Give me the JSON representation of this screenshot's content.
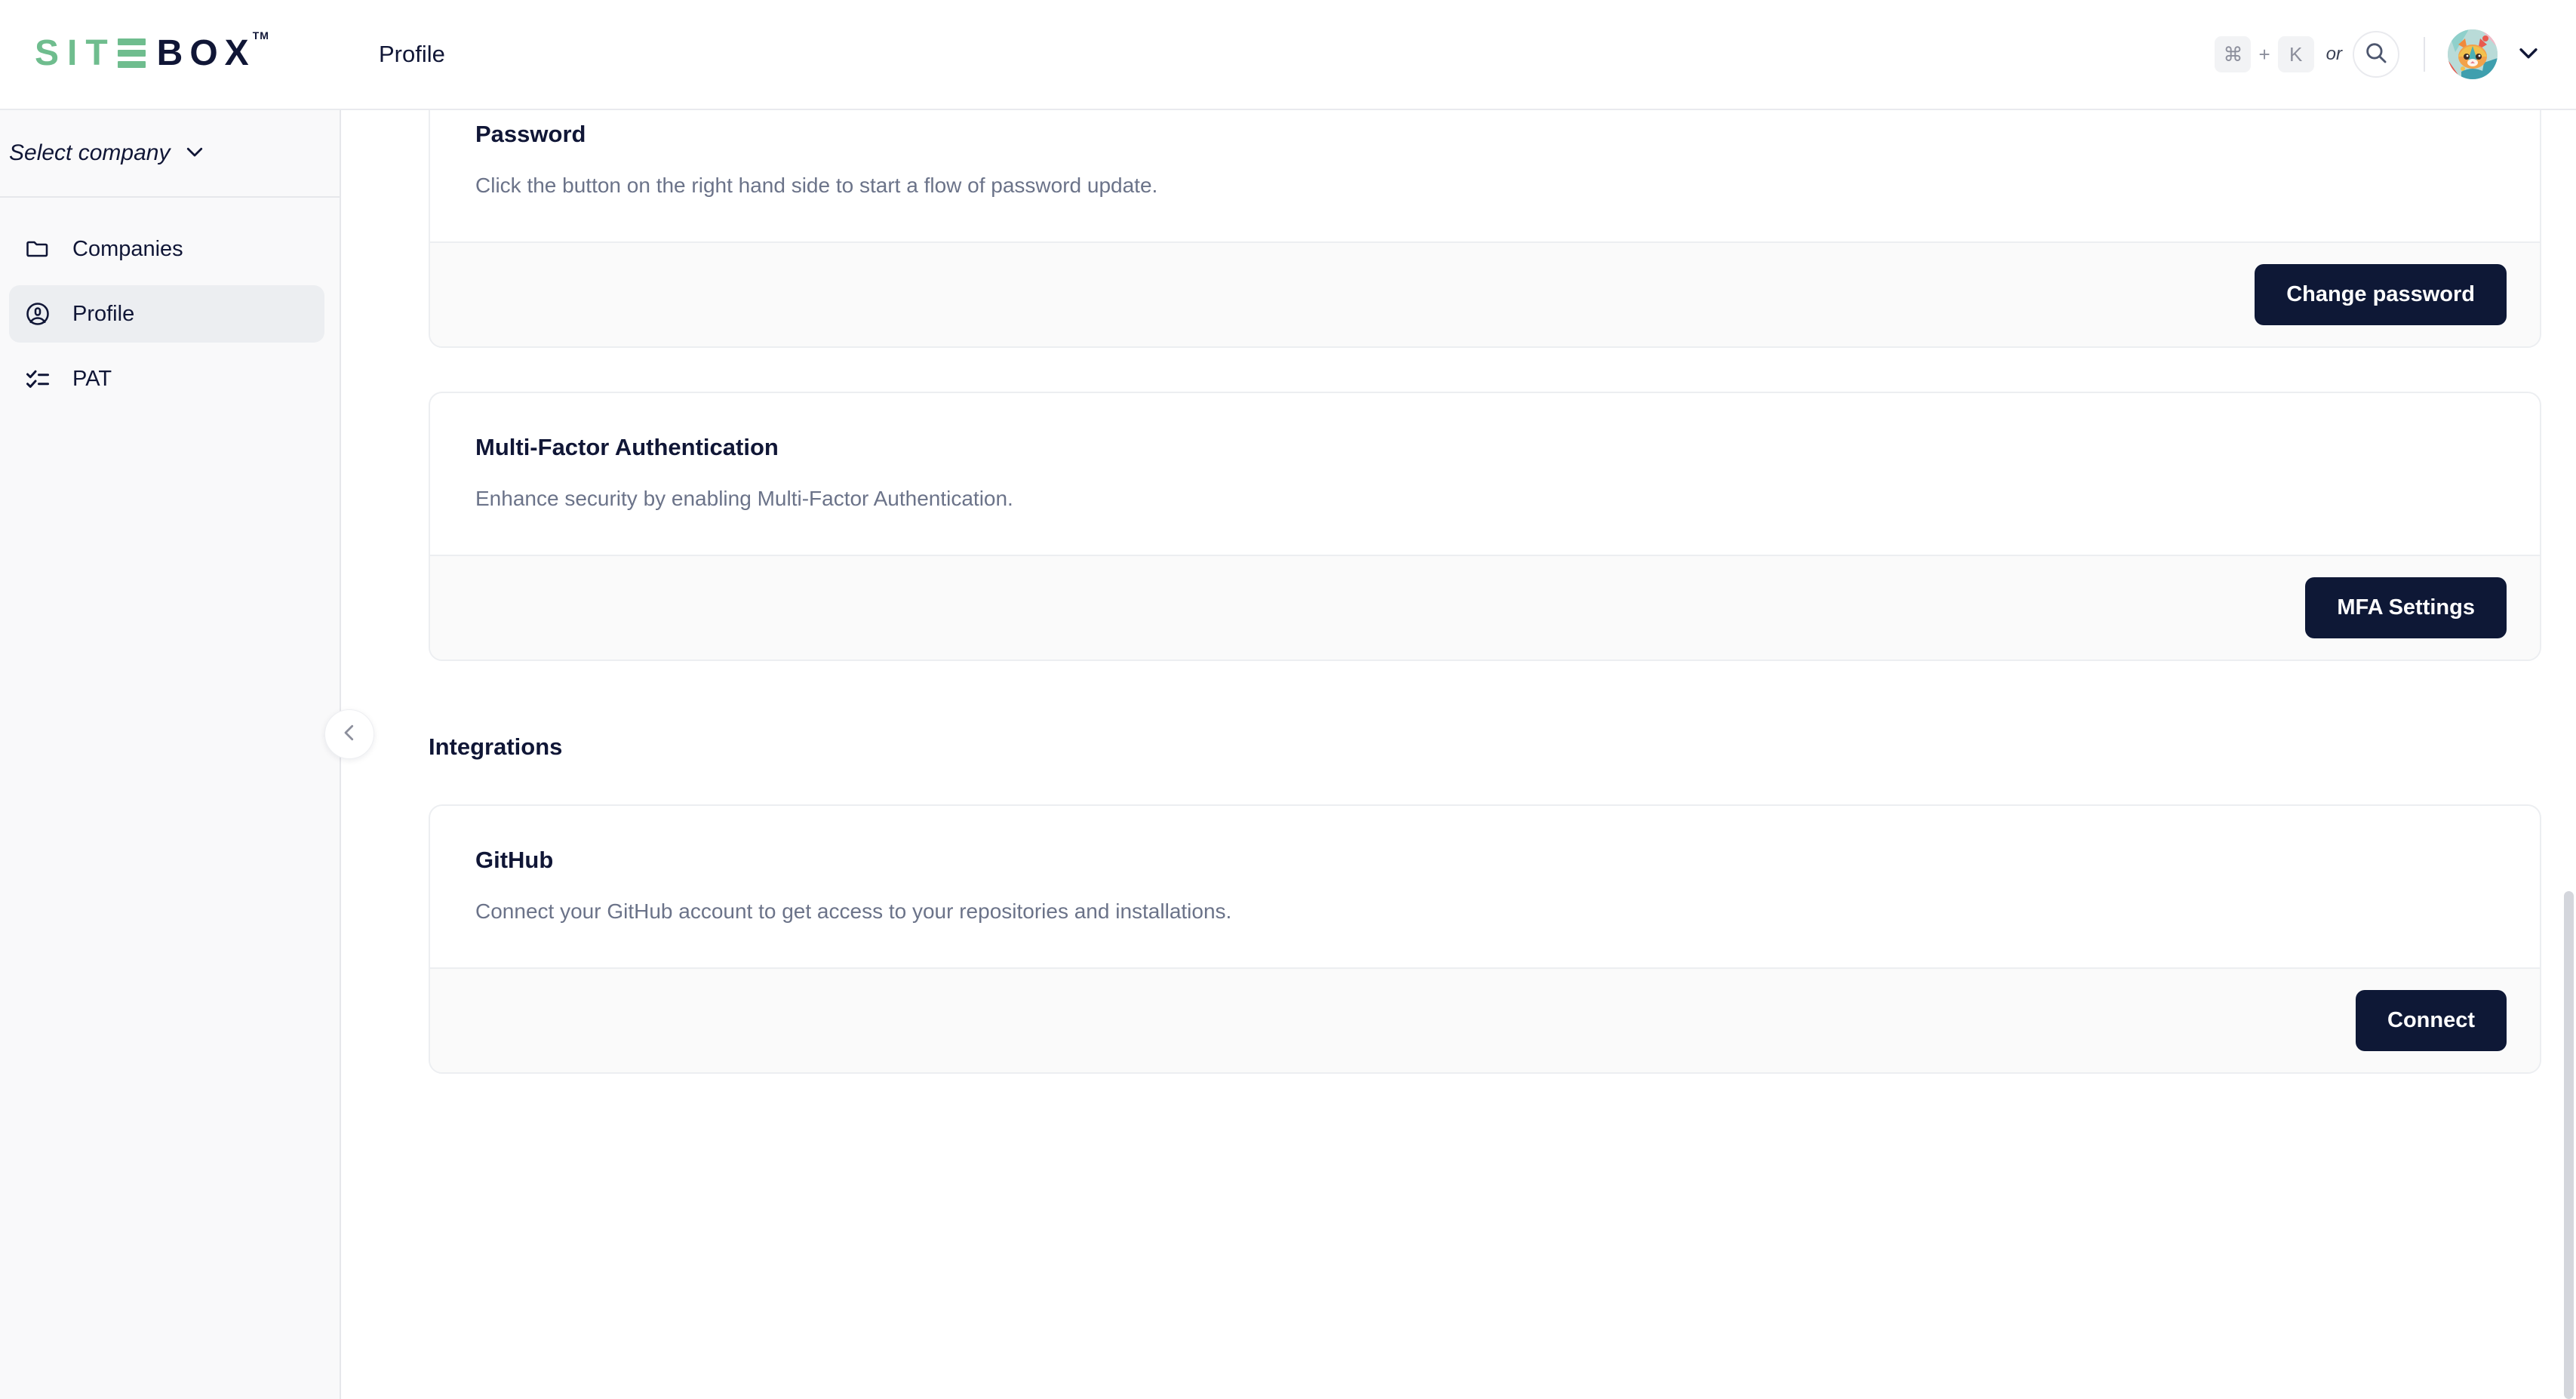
{
  "brand": {
    "logo_part1": "SIT",
    "logo_part2": "BOX",
    "logo_tm": "TM",
    "green": "#6fbd8e",
    "navy": "#101636"
  },
  "header": {
    "title": "Profile",
    "shortcut": {
      "cmd_key": "⌘",
      "plus": "+",
      "letter_key": "K",
      "or_label": "or"
    },
    "search_icon": "search-icon",
    "avatar_alt": "cat-avatar",
    "user_menu_icon": "chevron-down-icon"
  },
  "sidebar": {
    "company_selector": {
      "label": "Select company",
      "icon": "chevron-down-icon"
    },
    "items": [
      {
        "label": "Companies",
        "icon": "folder-icon",
        "active": false
      },
      {
        "label": "Profile",
        "icon": "user-circle-icon",
        "active": true
      },
      {
        "label": "PAT",
        "icon": "checklist-icon",
        "active": false
      }
    ],
    "collapse_icon": "chevron-left-icon"
  },
  "main": {
    "cards": [
      {
        "title": "Password",
        "description": "Click the button on the right hand side to start a flow of password update.",
        "action_label": "Change password"
      },
      {
        "title": "Multi-Factor Authentication",
        "description": "Enhance security by enabling Multi-Factor Authentication.",
        "action_label": "MFA Settings"
      }
    ],
    "integrations": {
      "section_title": "Integrations",
      "cards": [
        {
          "title": "GitHub",
          "description": "Connect your GitHub account to get access to your repositories and installations.",
          "action_label": "Connect"
        }
      ]
    }
  },
  "colors": {
    "button_bg": "#0e1836",
    "button_text": "#ffffff",
    "card_border": "#eceef1",
    "footer_bg": "#fafafa",
    "muted_text": "#6b7389"
  }
}
